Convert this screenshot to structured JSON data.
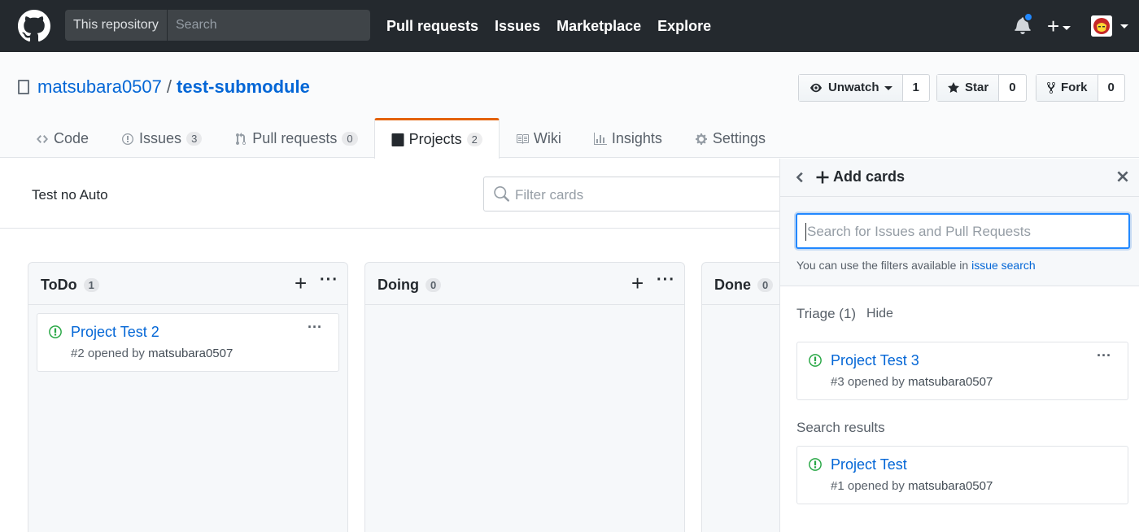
{
  "header": {
    "scope": "This repository",
    "search_placeholder": "Search",
    "nav": [
      "Pull requests",
      "Issues",
      "Marketplace",
      "Explore"
    ],
    "plus": "+",
    "colors": {
      "bg": "#24292e",
      "notification_dot": "#2188ff"
    }
  },
  "repo": {
    "owner": "matsubara0507",
    "separator": "/",
    "name": "test-submodule",
    "watch": {
      "label": "Unwatch",
      "count": "1"
    },
    "star": {
      "label": "Star",
      "count": "0"
    },
    "fork": {
      "label": "Fork",
      "count": "0"
    }
  },
  "tabs": [
    {
      "label": "Code",
      "icon": "code-icon"
    },
    {
      "label": "Issues",
      "count": "3",
      "icon": "issue-icon"
    },
    {
      "label": "Pull requests",
      "count": "0",
      "icon": "pull-request-icon"
    },
    {
      "label": "Projects",
      "count": "2",
      "icon": "project-icon",
      "selected": true
    },
    {
      "label": "Wiki",
      "icon": "book-icon"
    },
    {
      "label": "Insights",
      "icon": "graph-icon"
    },
    {
      "label": "Settings",
      "icon": "gear-icon"
    }
  ],
  "project": {
    "name": "Test no Auto",
    "filter_placeholder": "Filter cards"
  },
  "columns": [
    {
      "title": "ToDo",
      "count": "1",
      "cards": [
        {
          "title": "Project Test 2",
          "meta_prefix": "#2 opened by",
          "author": "matsubara0507"
        }
      ]
    },
    {
      "title": "Doing",
      "count": "0",
      "cards": []
    },
    {
      "title": "Done",
      "count": "0",
      "cards": []
    }
  ],
  "panel": {
    "title": "Add cards",
    "search_placeholder": "Search for Issues and Pull Requests",
    "help_text": "You can use the filters available in",
    "help_link": "issue search",
    "triage_label": "Triage (1)",
    "hide_label": "Hide",
    "triage_card": {
      "title": "Project Test 3",
      "meta_prefix": "#3 opened by",
      "author": "matsubara0507"
    },
    "results_label": "Search results",
    "result_card": {
      "title": "Project Test",
      "meta_prefix": "#1 opened by",
      "author": "matsubara0507"
    }
  },
  "colors": {
    "link": "#0366d6",
    "open_issue": "#28a745",
    "selected_tab": "#e36209"
  }
}
